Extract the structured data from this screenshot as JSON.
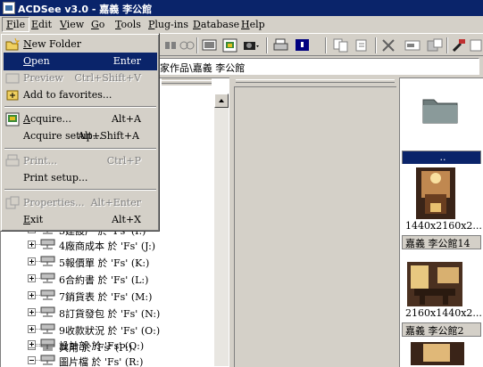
{
  "window": {
    "title": "ACDSee v3.0 - 嘉義 李公館"
  },
  "menubar": {
    "items": [
      {
        "key": "F",
        "rest": "ile"
      },
      {
        "key": "E",
        "rest": "dit"
      },
      {
        "key": "V",
        "rest": "iew"
      },
      {
        "key": "G",
        "rest": "o"
      },
      {
        "key": "T",
        "rest": "ools"
      },
      {
        "key": "P",
        "rest": "lug-ins"
      },
      {
        "key": "D",
        "rest": "atabase"
      },
      {
        "key": "H",
        "rest": "elp"
      }
    ]
  },
  "toolbar": {
    "icons": [
      "folder-up-icon",
      "browse-icon",
      "view-icon",
      "fullscreen-icon",
      "acquire-icon",
      "camera-icon",
      "print-icon",
      "slideshow-icon",
      "copy-icon",
      "move-icon",
      "delete-icon",
      "rename-icon",
      "properties-icon",
      "tools-icon"
    ]
  },
  "address": {
    "path": "家作品\\嘉義 李公館"
  },
  "file_menu": {
    "items": [
      {
        "type": "item",
        "key": "N",
        "label": "ew Folder",
        "shortcut": "",
        "icon": "new-folder-icon",
        "state": "normal"
      },
      {
        "type": "item",
        "key": "O",
        "label": "pen",
        "shortcut": "Enter",
        "icon": "",
        "state": "highlighted"
      },
      {
        "type": "item",
        "key": "",
        "label": "Preview",
        "shortcut": "Ctrl+Shift+V",
        "icon": "preview-icon",
        "state": "disabled"
      },
      {
        "type": "item",
        "key": "",
        "label": "Add to favorites...",
        "shortcut": "",
        "icon": "favorites-icon",
        "state": "normal"
      },
      {
        "type": "sep"
      },
      {
        "type": "item",
        "key": "A",
        "label": "cquire...",
        "shortcut": "Alt+A",
        "icon": "acquire-icon",
        "state": "normal"
      },
      {
        "type": "item",
        "key": "",
        "label": "Acquire setup...",
        "shortcut": "Alt+Shift+A",
        "icon": "",
        "state": "normal"
      },
      {
        "type": "sep"
      },
      {
        "type": "item",
        "key": "",
        "label": "Print...",
        "shortcut": "Ctrl+P",
        "icon": "print-icon",
        "state": "disabled"
      },
      {
        "type": "item",
        "key": "",
        "label": "Print setup...",
        "shortcut": "",
        "icon": "",
        "state": "normal"
      },
      {
        "type": "sep"
      },
      {
        "type": "item",
        "key": "",
        "label": "Properties...",
        "shortcut": "Alt+Enter",
        "icon": "properties-icon",
        "state": "disabled"
      },
      {
        "type": "item",
        "key": "E",
        "label": "xit",
        "shortcut": "Alt+X",
        "icon": "",
        "state": "normal"
      }
    ]
  },
  "tree": {
    "rows": [
      {
        "label": "3建設厂 於 'Fs' (I:)",
        "expander": "plus"
      },
      {
        "label": "4廠商成本 於 'Fs' (J:)",
        "expander": "plus"
      },
      {
        "label": "5報價單 於 'Fs' (K:)",
        "expander": "plus"
      },
      {
        "label": "6合約書 於 'Fs' (L:)",
        "expander": "plus"
      },
      {
        "label": "7銷貨表 於 'Fs' (M:)",
        "expander": "plus"
      },
      {
        "label": "8訂貨發包 於 'Fs' (N:)",
        "expander": "plus"
      },
      {
        "label": "9收款狀況 於 'Fs' (O:)",
        "expander": "plus"
      },
      {
        "label": "共用 於 'Fs' (P:)",
        "expander": "plus"
      },
      {
        "label": "設計部 於 'Fs' (Q:)",
        "expander": "plus"
      },
      {
        "label": "圖片檔 於 'Fs' (R:)",
        "expander": "minus"
      }
    ]
  },
  "thumbnails": [
    {
      "kind": "folder",
      "caption": "",
      "name": "..",
      "selected": true
    },
    {
      "kind": "image",
      "caption": "1440x2160x2...",
      "name": "嘉義 李公館14",
      "selected": false
    },
    {
      "kind": "image",
      "caption": "2160x1440x2...",
      "name": "嘉義 李公館2",
      "selected": false
    }
  ],
  "colors": {
    "titlebar": "#0a246a",
    "face": "#d4d0c8",
    "highlight": "#0a246a"
  }
}
